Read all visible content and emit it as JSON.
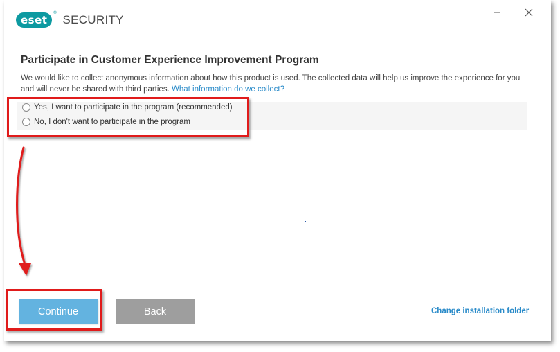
{
  "app": {
    "logo_badge": "eset",
    "logo_reg": "®",
    "product_name": "SECURITY"
  },
  "window_controls": {
    "minimize_icon": "minimize-icon",
    "close_icon": "close-icon"
  },
  "page": {
    "heading": "Participate in Customer Experience Improvement Program",
    "description": "We would like to collect anonymous information about how this product is used. The collected data will help us improve the experience for you and will never be shared with third parties.",
    "info_link": "What information do we collect?"
  },
  "options": [
    {
      "label": "Yes, I want to participate in the program (recommended)",
      "selected": false
    },
    {
      "label": "No, I don't want to participate in the program",
      "selected": false
    }
  ],
  "footer": {
    "continue_label": "Continue",
    "back_label": "Back",
    "change_folder_label": "Change installation folder"
  },
  "colors": {
    "brand": "#0d9aa1",
    "primary_button": "#63b3e0",
    "secondary_button": "#9e9e9e",
    "link": "#2a8bc9",
    "annotation": "#e01b1b"
  }
}
